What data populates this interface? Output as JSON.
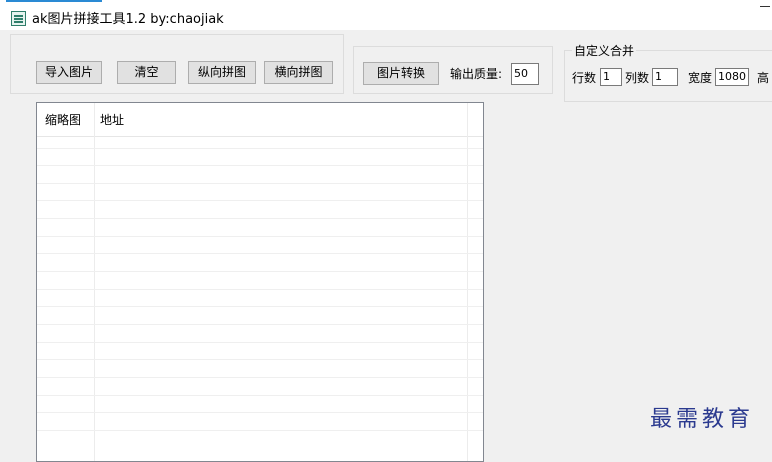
{
  "window": {
    "title": "ak图片拼接工具1.2  by:chaojiak"
  },
  "toolbar": {
    "import_label": "导入图片",
    "clear_label": "清空",
    "vertical_label": "纵向拼图",
    "horizontal_label": "横向拼图"
  },
  "convert": {
    "button_label": "图片转换",
    "quality_label": "输出质量:",
    "quality_value": "50"
  },
  "custom_merge": {
    "legend": "自定义合并",
    "rows_label": "行数",
    "rows_value": "1",
    "cols_label": "列数",
    "cols_value": "1",
    "width_label": "宽度",
    "width_value": "1080",
    "height_label": "高"
  },
  "list": {
    "columns": [
      "缩略图",
      "地址"
    ],
    "rows": []
  },
  "watermark": "最需教育",
  "colors": {
    "window_bg": "#f0f0f0",
    "button_bg": "#e1e1e1",
    "title_accent": "#2a8ad4",
    "watermark": "#2b3a8f"
  }
}
